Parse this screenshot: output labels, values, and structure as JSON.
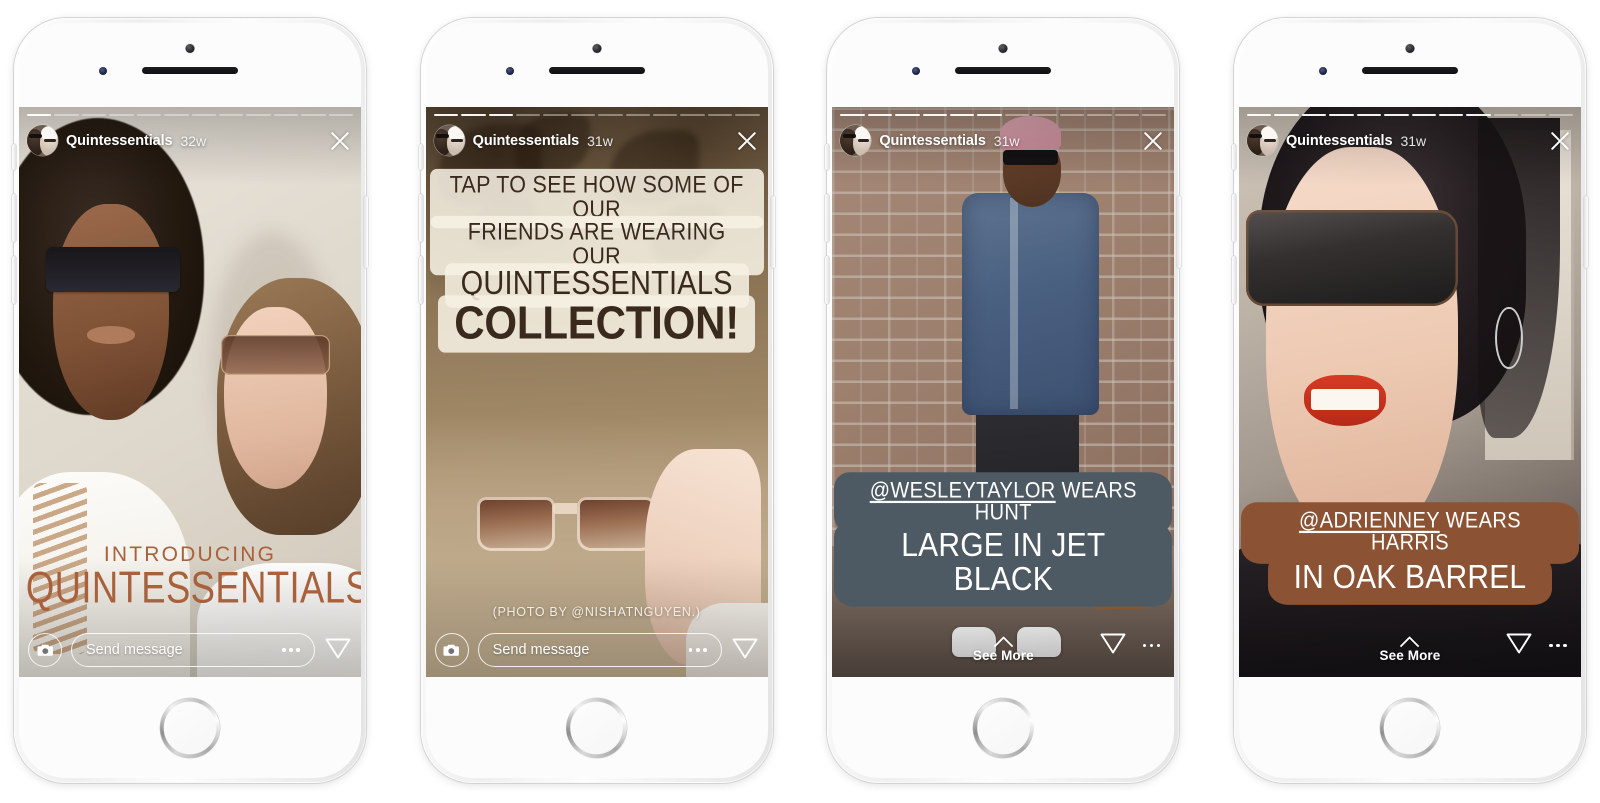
{
  "account": {
    "name": "Quintessentials",
    "avatar_alt": "quintessentials-profile-thumbnail"
  },
  "icons": {
    "close": "close-icon",
    "camera": "camera-icon",
    "send": "send-plane-icon",
    "more": "more-options-icon",
    "chevron_up": "chevron-up-icon"
  },
  "ui": {
    "send_message_placeholder": "Send message",
    "see_more_label": "See More"
  },
  "stories": [
    {
      "id": "story-1-introducing",
      "time_ago": "32w",
      "segments": 12,
      "active_segment": 1,
      "caption": {
        "line1": "INTRODUCING",
        "line2": "QUINTESSENTIALS"
      },
      "caption_color": "#a9613c",
      "bottom_bar": "message",
      "photo_description": "Two models wearing sunglasses against a warm beige wall"
    },
    {
      "id": "story-2-tap-to-see",
      "time_ago": "31w",
      "segments": 12,
      "active_segment": 3,
      "caption": {
        "line1": "TAP TO SEE HOW SOME OF OUR",
        "line2": "FRIENDS ARE WEARING OUR",
        "line3": "QUINTESSENTIALS",
        "line4": "COLLECTION!"
      },
      "credit": "(PHOTO BY @NISHATNGUYEN.)",
      "bottom_bar": "message",
      "photo_description": "Hand holding clear-framed sunglasses in dappled sunlight"
    },
    {
      "id": "story-3-wesleytaylor",
      "time_ago": "31w",
      "segments": 12,
      "active_segment": 6,
      "caption": {
        "handle": "@WESLEYTAYLOR",
        "line1_rest": " WEARS HUNT",
        "line2": "LARGE IN JET BLACK"
      },
      "caption_bg": "#4e5a63",
      "bottom_bar": "see-more",
      "photo_description": "Man in denim shirt leaning against a brick wall"
    },
    {
      "id": "story-4-adrienney",
      "time_ago": "31w",
      "segments": 12,
      "active_segment": 9,
      "caption": {
        "handle": "@ADRIENNEY",
        "line1_rest": " WEARS HARRIS",
        "line2": "IN OAK BARREL"
      },
      "caption_bg": "#8b5334",
      "bottom_bar": "see-more",
      "photo_description": "Woman in large sunglasses and red lipstick smiling"
    }
  ]
}
